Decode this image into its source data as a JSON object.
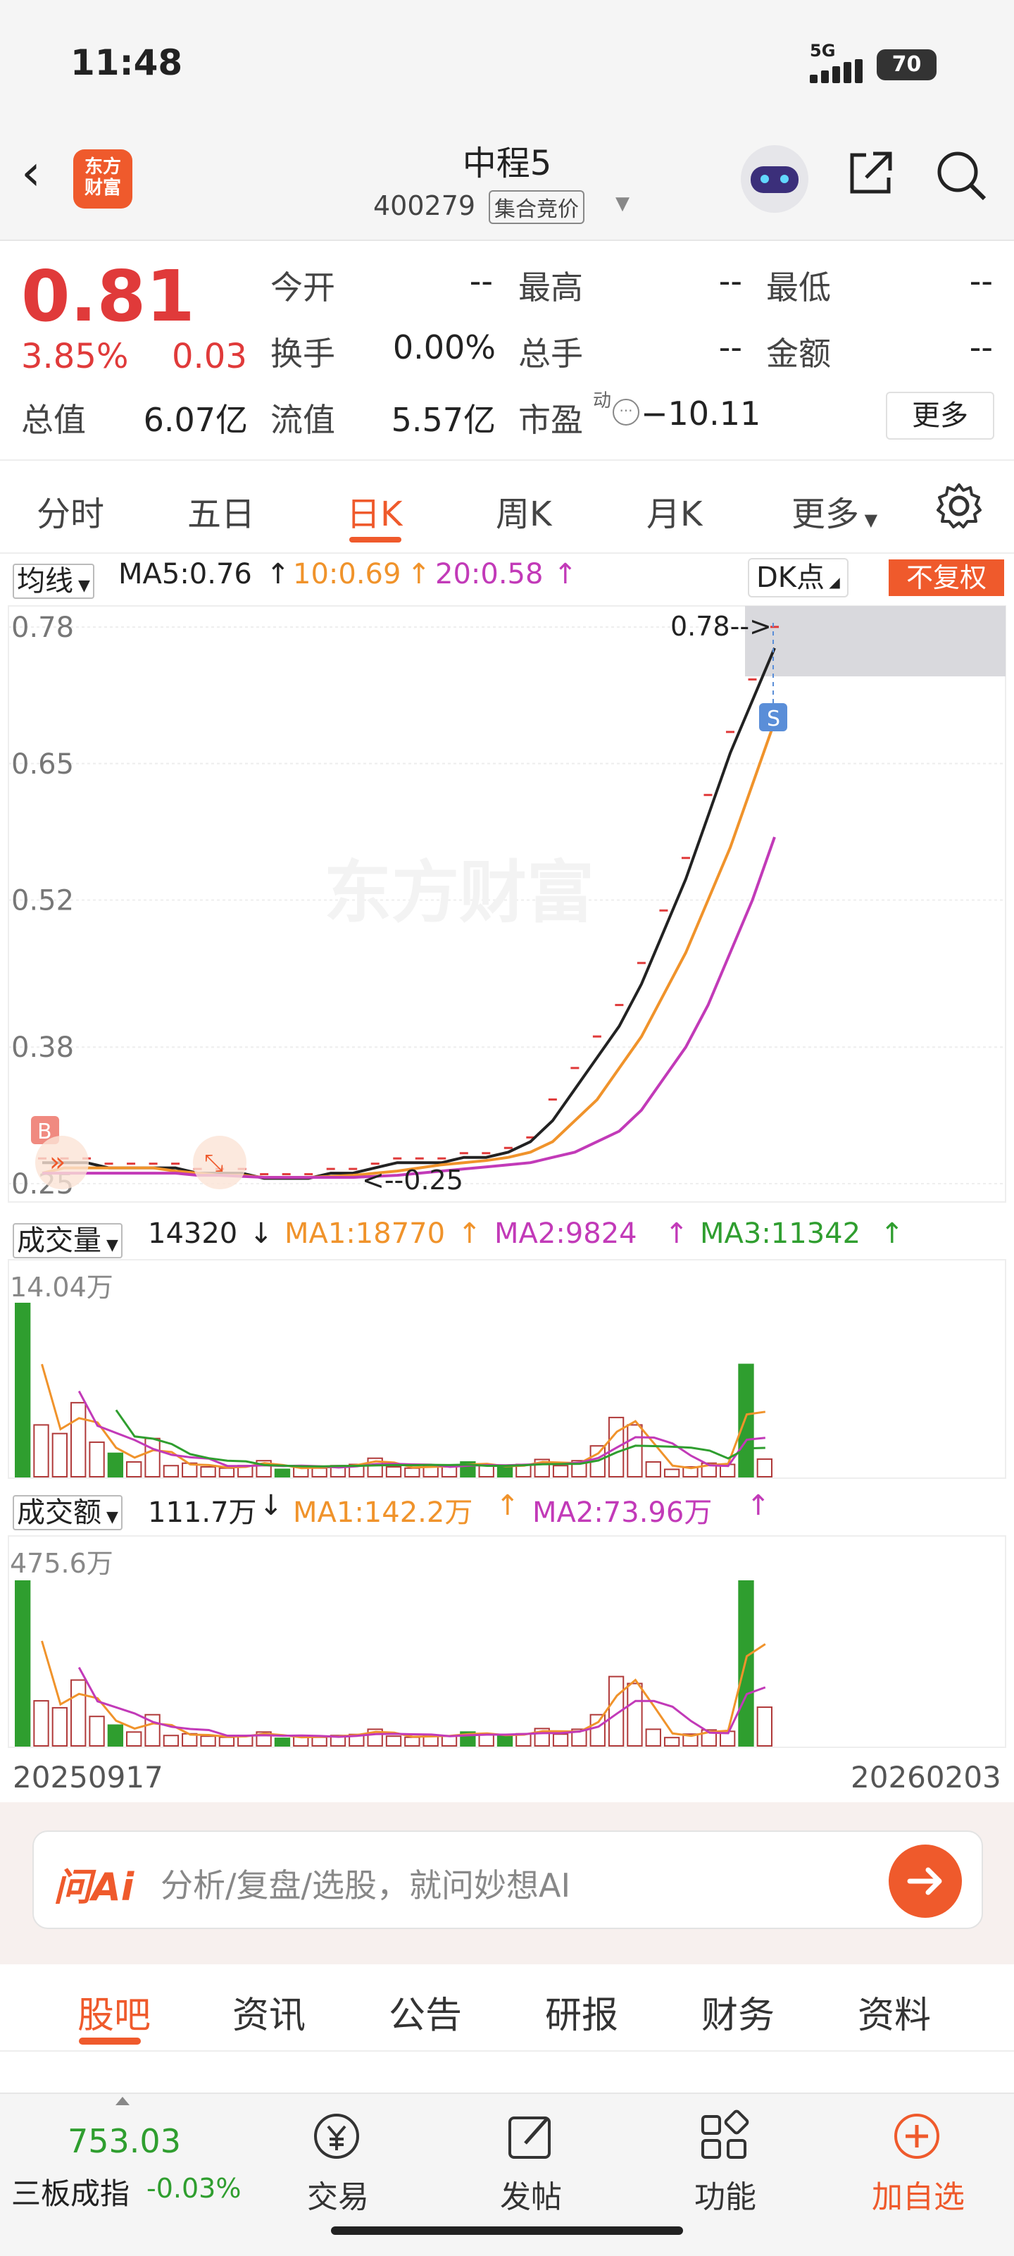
{
  "status_bar": {
    "time": "11:48",
    "network": "5G",
    "battery": "70"
  },
  "header": {
    "logo_text": "东方\n财富",
    "stock_name": "中程5",
    "stock_code": "400279",
    "trading_phase": "集合竞价",
    "icons": [
      "back-icon",
      "robot-avatar-icon",
      "share-icon",
      "search-icon"
    ]
  },
  "quote": {
    "price": "0.81",
    "change_pct": "3.85%",
    "change": "0.03",
    "fields": [
      {
        "label": "今开",
        "value": "--"
      },
      {
        "label": "最高",
        "value": "--"
      },
      {
        "label": "最低",
        "value": "--"
      },
      {
        "label": "换手",
        "value": "0.00%"
      },
      {
        "label": "总手",
        "value": "--"
      },
      {
        "label": "金额",
        "value": "--"
      },
      {
        "label": "总值",
        "value": "6.07亿"
      },
      {
        "label": "流值",
        "value": "5.57亿"
      },
      {
        "label": "市盈",
        "value": "−10.11"
      }
    ],
    "pe_sup": "动",
    "more_label": "更多"
  },
  "chart_tabs": {
    "items": [
      "分时",
      "五日",
      "日K",
      "周K",
      "月K",
      "更多"
    ],
    "active": "日K"
  },
  "price_chart": {
    "ma_selector": "均线",
    "ma5": "MA5:0.76",
    "ma10": "10:0.69",
    "ma20": "20:0.58",
    "dk_label": "DK点",
    "adjust_label": "不复权",
    "watermark": "东方财富",
    "high_marker": "0.78-->",
    "low_marker": "<--0.25",
    "buy_mark": "B",
    "sell_mark": "S"
  },
  "volume": {
    "selector": "成交量",
    "value": "14320",
    "ma1": "MA1:18770",
    "ma2": "MA2:9824",
    "ma3": "MA3:11342",
    "max_label": "14.04万"
  },
  "amount": {
    "selector": "成交额",
    "value": "111.7万",
    "ma1": "MA1:142.2万",
    "ma2": "MA2:73.96万",
    "max_label": "475.6万"
  },
  "date_range": {
    "start": "20250917",
    "end": "20260203"
  },
  "chart_data": {
    "type": "line",
    "title": "",
    "yticks": [
      "0.78",
      "0.65",
      "0.52",
      "0.38",
      "0.25"
    ],
    "ylim": [
      0.25,
      0.78
    ],
    "series": [
      {
        "name": "MA5",
        "color": "#222222",
        "values": [
          0.27,
          0.27,
          0.27,
          0.265,
          0.265,
          0.265,
          0.265,
          0.26,
          0.26,
          0.26,
          0.255,
          0.255,
          0.255,
          0.26,
          0.26,
          0.265,
          0.27,
          0.27,
          0.27,
          0.275,
          0.275,
          0.28,
          0.29,
          0.31,
          0.34,
          0.37,
          0.4,
          0.44,
          0.49,
          0.54,
          0.6,
          0.66,
          0.71,
          0.76
        ]
      },
      {
        "name": "MA10",
        "color": "#f0932b",
        "values": [
          0.26,
          0.265,
          0.265,
          0.265,
          0.265,
          0.265,
          0.262,
          0.26,
          0.258,
          0.258,
          0.256,
          0.256,
          0.256,
          0.257,
          0.258,
          0.26,
          0.262,
          0.265,
          0.268,
          0.27,
          0.272,
          0.275,
          0.28,
          0.29,
          0.31,
          0.33,
          0.36,
          0.39,
          0.43,
          0.47,
          0.52,
          0.57,
          0.63,
          0.69
        ]
      },
      {
        "name": "MA20",
        "color": "#c23ab8",
        "values": [
          0.26,
          0.26,
          0.26,
          0.26,
          0.26,
          0.26,
          0.26,
          0.258,
          0.258,
          0.257,
          0.256,
          0.256,
          0.256,
          0.256,
          0.256,
          0.257,
          0.258,
          0.26,
          0.262,
          0.264,
          0.266,
          0.268,
          0.27,
          0.275,
          0.28,
          0.29,
          0.3,
          0.32,
          0.35,
          0.38,
          0.42,
          0.47,
          0.52,
          0.58
        ]
      }
    ],
    "volume_bars": [
      14.04,
      4.2,
      3.5,
      6.0,
      2.8,
      1.9,
      1.2,
      3.1,
      0.9,
      1.1,
      0.8,
      0.7,
      0.9,
      1.3,
      0.6,
      0.8,
      0.7,
      0.9,
      1.0,
      1.5,
      0.8,
      0.7,
      0.9,
      0.8,
      1.2,
      0.9,
      0.8,
      1.0,
      1.4,
      0.9,
      1.3,
      2.5,
      4.8,
      4.2,
      1.2,
      0.6,
      0.8,
      1.1,
      1.0,
      9.1,
      1.43
    ],
    "amount_bars": [
      475.6,
      130,
      110,
      190,
      85,
      60,
      40,
      90,
      30,
      35,
      28,
      25,
      30,
      40,
      22,
      28,
      25,
      30,
      33,
      48,
      28,
      25,
      30,
      28,
      40,
      32,
      30,
      35,
      50,
      34,
      48,
      90,
      200,
      180,
      48,
      24,
      34,
      46,
      42,
      475.6,
      111.7
    ]
  },
  "ai_bar": {
    "logo": "问Ai",
    "placeholder": "分析/复盘/选股，就问妙想AI"
  },
  "lower_tabs": {
    "items": [
      "股吧",
      "资讯",
      "公告",
      "研报",
      "财务",
      "资料"
    ],
    "active": "股吧"
  },
  "bottom_nav": {
    "index_value": "753.03",
    "index_name": "三板成指",
    "index_change": "-0.03%",
    "items": [
      {
        "label": "交易",
        "icon": "trade-icon"
      },
      {
        "label": "发帖",
        "icon": "post-icon"
      },
      {
        "label": "功能",
        "icon": "grid-icon"
      },
      {
        "label": "加自选",
        "icon": "add-favorite-icon"
      }
    ]
  },
  "colors": {
    "accent": "#ef5a2c",
    "up": "#e03a3a",
    "down": "#2f9e2f",
    "ma10": "#f0932b",
    "ma20": "#c23ab8"
  }
}
